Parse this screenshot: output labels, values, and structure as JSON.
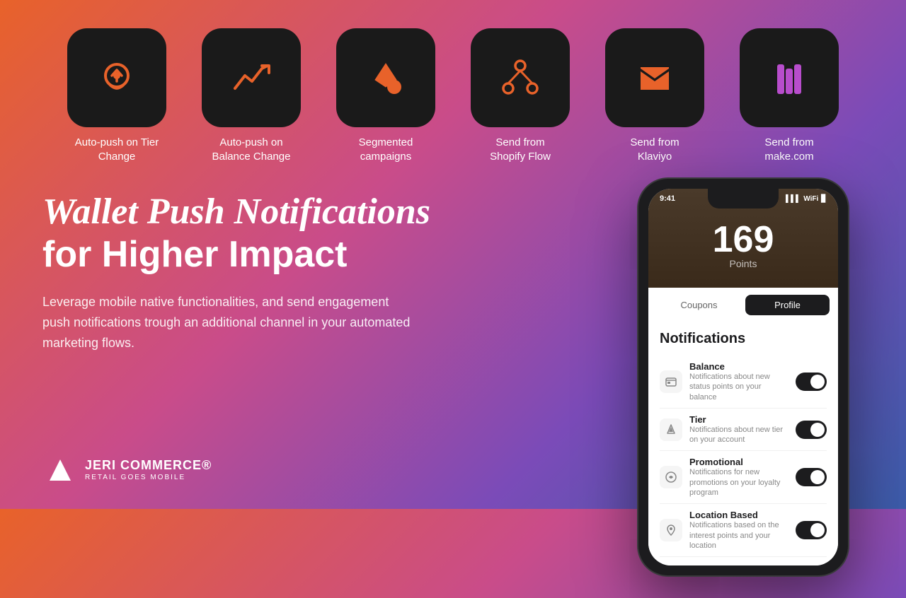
{
  "icons": [
    {
      "id": "auto-push-tier",
      "label": "Auto-push on\nTier Change",
      "color": "#e8622a",
      "type": "medal"
    },
    {
      "id": "auto-push-balance",
      "label": "Auto-push on\nBalance Change",
      "color": "#e8622a",
      "type": "chart"
    },
    {
      "id": "segmented-campaigns",
      "label": "Segmented\ncampaigns",
      "color": "#e8622a",
      "type": "shapes"
    },
    {
      "id": "send-from-shopify",
      "label": "Send from\nShopify Flow",
      "color": "#e8622a",
      "type": "git"
    },
    {
      "id": "send-from-klaviyo",
      "label": "Send from\nKlaviyo",
      "color": "#e8622a",
      "type": "flag"
    },
    {
      "id": "send-from-make",
      "label": "Send from\nmake.com",
      "color": "#b84dcc",
      "type": "books"
    }
  ],
  "headline": {
    "italic": "Wallet Push Notifications",
    "normal": "for Higher Impact"
  },
  "description": "Leverage mobile native functionalities, and send engagement push notifications trough an additional channel in your automated marketing flows.",
  "phone": {
    "time": "9:41",
    "points": "169",
    "points_label": "Points",
    "tab_coupons": "Coupons",
    "tab_profile": "Profile",
    "notifications_title": "Notifications",
    "notifications": [
      {
        "name": "Balance",
        "desc": "Notifications about new status points on your balance"
      },
      {
        "name": "Tier",
        "desc": "Notifications about new tier on your account"
      },
      {
        "name": "Promotional",
        "desc": "Notifications for new promotions on your loyalty program"
      },
      {
        "name": "Location Based",
        "desc": "Notifications based on the interest points and your location"
      }
    ]
  },
  "logo": {
    "brand": "JERI",
    "commerce": "COMMERCE®",
    "tagline": "RETAIL GOES MOBILE"
  }
}
